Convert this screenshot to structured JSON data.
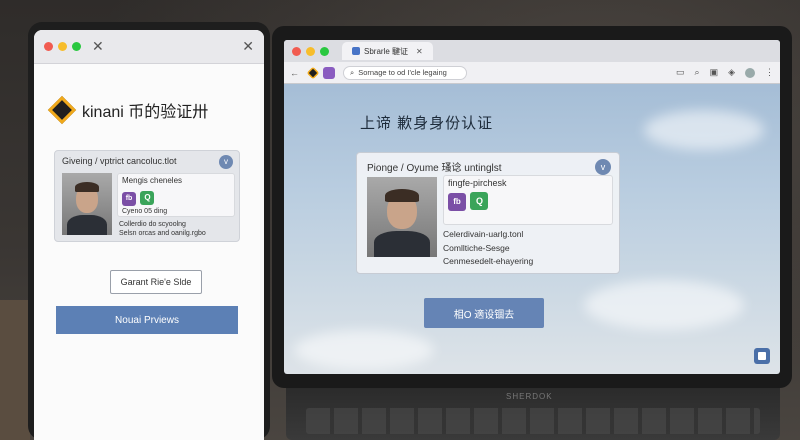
{
  "phone": {
    "brand": "kinani 币的验证卅",
    "card": {
      "header": "Giveing / vptrict cancoluc.tlot",
      "name_line": "Mengis cheneles",
      "code_line": "Cyeno 05 ding",
      "detail_1": "Collerdio do scyoolng",
      "detail_2": "Selsn orcas and oanilg.rgbo"
    },
    "secondary_button": "Garant Rie'e Slde",
    "primary_button": "Nouai Prviews"
  },
  "laptop": {
    "tab_title": "Sbrarle 騝证",
    "address_text": "Sornage to od I'cle legaing",
    "page_title": "上谛 歉身身份认证",
    "card": {
      "header": "Pionge / Oyume 瑵谂 untinglst",
      "name_line": "fingfe-pirchesk",
      "field_1": "Celerdivain-uarlg.tonl",
      "field_2": "Comlltiche-Sesge",
      "field_3": "Cenmesedelt-ehayering"
    },
    "primary_button": "相O 適设锢去",
    "base_label": "SHERDOK"
  },
  "icons": {
    "card_chevron": "v",
    "card_badge_left": "fb",
    "card_badge_right": "Q",
    "close": "✕",
    "back": "←",
    "search": "⌕",
    "zoom": "⌕"
  },
  "colors": {
    "accent_blue": "#5c80b5",
    "logo_gold": "#f0a91b",
    "badge_purple": "#7b4fa6",
    "badge_green": "#3aa45a"
  }
}
